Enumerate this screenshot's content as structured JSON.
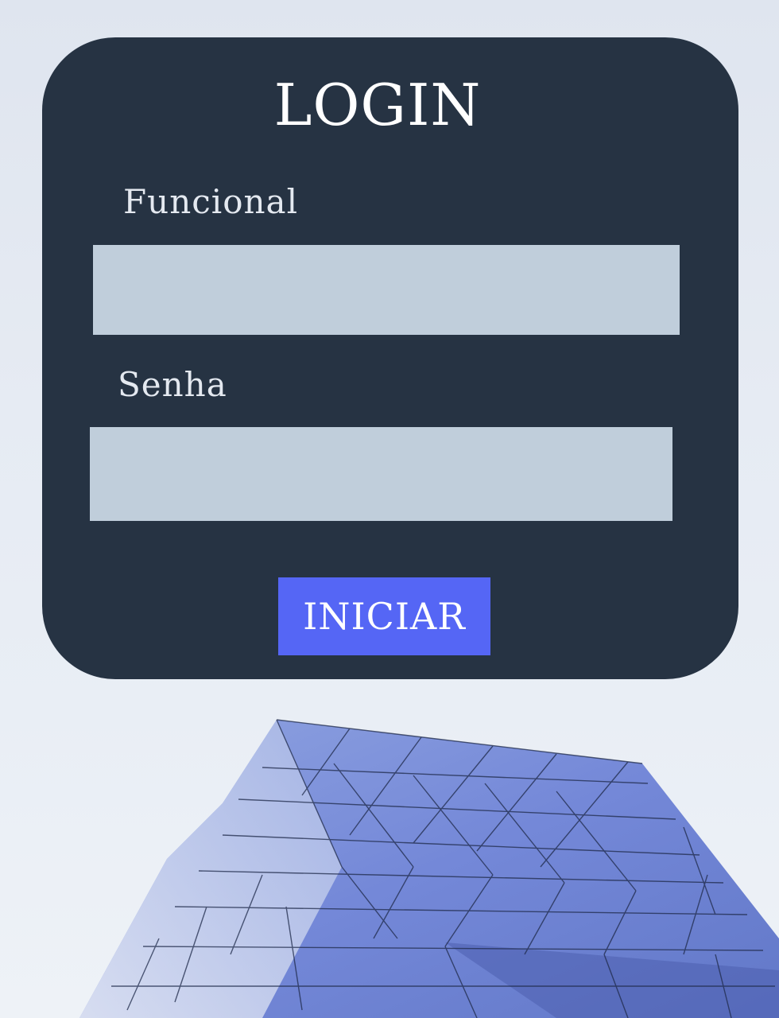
{
  "login": {
    "title": "LOGIN",
    "functional_label": "Funcional",
    "functional_value": "",
    "password_label": "Senha",
    "password_value": "",
    "submit_label": "INICIAR"
  },
  "colors": {
    "card_background": "#263343",
    "input_background": "#c0cedb",
    "button_background": "#5566f5",
    "text": "#ffffff"
  },
  "background": {
    "image_subject": "architecture-facade-photo"
  }
}
